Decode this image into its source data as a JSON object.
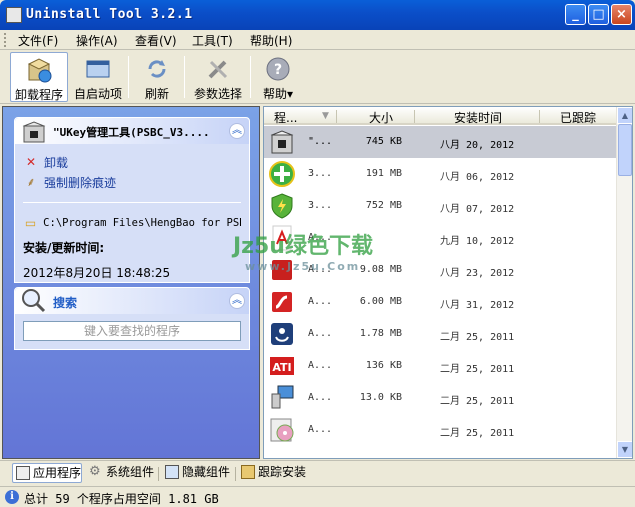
{
  "window": {
    "title": "Uninstall Tool 3.2.1",
    "minimize": "_",
    "maximize": "□",
    "close": "×"
  },
  "menu": [
    "文件(F)",
    "操作(A)",
    "查看(V)",
    "工具(T)",
    "帮助(H)"
  ],
  "toolbar": [
    {
      "label": "卸载程序",
      "icon": "uninstall-box-icon"
    },
    {
      "label": "自启动项",
      "icon": "startup-window-icon"
    },
    {
      "label": "刷新",
      "icon": "refresh-icon"
    },
    {
      "label": "参数选择",
      "icon": "wrench-icon"
    },
    {
      "label": "帮助▾",
      "icon": "help-icon"
    }
  ],
  "details_card": {
    "title": "\"UKey管理工具(PSBC_V3....",
    "uninstall": "卸载",
    "force_remove": "强制删除痕迹",
    "path": "C:\\Program Files\\HengBao for PSBC",
    "install_time_label": "安装/更新时间:",
    "install_time_value": "2012年8月20日  18:48:25"
  },
  "search_card": {
    "title": "搜索",
    "placeholder": "键入要查找的程序"
  },
  "list": {
    "columns": [
      "程...",
      "大小",
      "安装时间",
      "已跟踪"
    ],
    "rows": [
      {
        "name": "\"...",
        "size": "745 KB",
        "date": "八月 20, 2012",
        "icon": "ukey-box-icon",
        "selected": true
      },
      {
        "name": "3...",
        "size": "191 MB",
        "date": "八月 06, 2012",
        "icon": "green-plus-icon"
      },
      {
        "name": "3...",
        "size": "752 MB",
        "date": "八月 07, 2012",
        "icon": "green-shield-icon"
      },
      {
        "name": "A...",
        "size": "",
        "date": "九月 10, 2012",
        "icon": "acrobat-icon"
      },
      {
        "name": "A...",
        "size": "9.08 MB",
        "date": "八月 23, 2012",
        "icon": "red-box-icon"
      },
      {
        "name": "A...",
        "size": "6.00 MB",
        "date": "八月 31, 2012",
        "icon": "flash-icon"
      },
      {
        "name": "A...",
        "size": "1.78 MB",
        "date": "二月 25, 2011",
        "icon": "blue-app-icon"
      },
      {
        "name": "A...",
        "size": "136 KB",
        "date": "二月 25, 2011",
        "icon": "ati-icon"
      },
      {
        "name": "A...",
        "size": "13.0 KB",
        "date": "二月 25, 2011",
        "icon": "monitor-icon"
      },
      {
        "name": "A...",
        "size": "",
        "date": "二月 25, 2011",
        "icon": "disc-icon"
      }
    ]
  },
  "watermark": {
    "line1": "Jz5u绿色下载",
    "line2": "www.Jz5u.Com"
  },
  "tabs": [
    {
      "label": "应用程序",
      "icon": "apps-icon"
    },
    {
      "label": "系统组件",
      "icon": "gear-icon"
    },
    {
      "label": "隐藏组件",
      "icon": "hidden-icon"
    },
    {
      "label": "跟踪安装",
      "icon": "track-icon"
    }
  ],
  "status": {
    "text": "总计 59 个程序占用空间 1.81 GB"
  }
}
